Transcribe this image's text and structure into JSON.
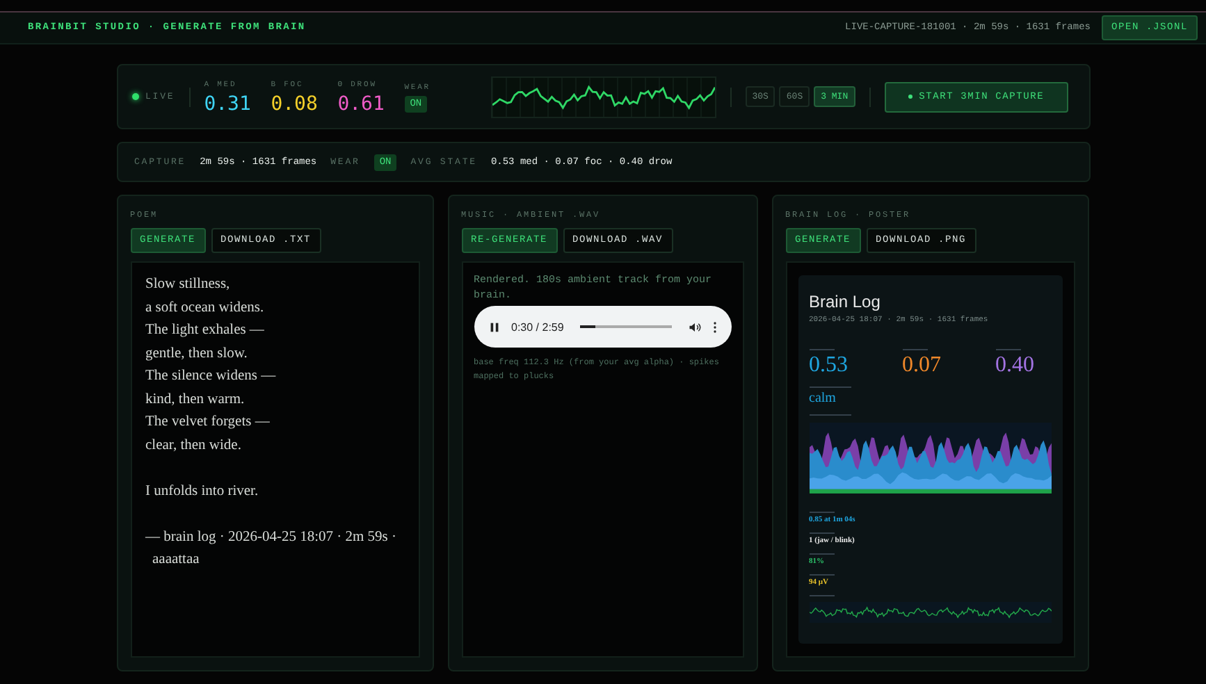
{
  "header": {
    "title": "BRAINBIT STUDIO · GENERATE FROM BRAIN",
    "session": "LIVE-CAPTURE-181001 · 2m 59s · 1631 frames",
    "action": "OPEN .JSONL"
  },
  "live": {
    "status": "LIVE",
    "on": true,
    "metrics": [
      {
        "label": "Α MED",
        "value": "0.31",
        "color": "#3fd4f4"
      },
      {
        "label": "Β FOC",
        "value": "0.08",
        "color": "#f4d02a"
      },
      {
        "label": "Θ DROW",
        "value": "0.61",
        "color": "#f05cc8"
      }
    ],
    "wear": {
      "label": "WEAR",
      "value": "ON",
      "on": true
    },
    "durations": [
      {
        "label": "30S",
        "selected": false
      },
      {
        "label": "60S",
        "selected": false
      },
      {
        "label": "3 MIN",
        "selected": true
      }
    ],
    "start": "START 3MIN CAPTURE"
  },
  "summary": {
    "capture_label": "CAPTURE",
    "capture": "2m 59s · 1631 frames",
    "wear_label": "WEAR",
    "wear": "ON",
    "wear_on": true,
    "avg_label": "AVG STATE",
    "avg": "0.53 med · 0.07 foc · 0.40 drow"
  },
  "panels": [
    {
      "kind": "poem",
      "title": "POEM",
      "buttons": [
        {
          "label": "GENERATE",
          "primary": true
        },
        {
          "label": "DOWNLOAD .TXT",
          "primary": false
        }
      ],
      "stanzas": [
        [
          "Slow stillness,",
          "a soft ocean widens.",
          "The light exhales —",
          "gentle, then slow.",
          "The silence widens —",
          "kind, then warm.",
          "The velvet forgets —",
          "clear, then wide."
        ],
        [
          "I unfolds into river."
        ],
        [
          "— brain log · 2026-04-25 18:07 · 2m 59s ·",
          "aaaattaa"
        ]
      ]
    },
    {
      "kind": "music",
      "title": "MUSIC · AMBIENT .WAV",
      "buttons": [
        {
          "label": "RE-GENERATE",
          "primary": true
        },
        {
          "label": "DOWNLOAD .WAV",
          "primary": false
        }
      ],
      "status": "Rendered. 180s ambient track from your brain.",
      "player": {
        "playing": true,
        "time": "0:30 / 2:59",
        "level": 0.17
      },
      "note": "base freq 112.3 Hz (from your avg alpha) · spikes mapped to plucks"
    },
    {
      "kind": "poster",
      "title": "BRAIN LOG · POSTER",
      "buttons": [
        {
          "label": "GENERATE",
          "primary": true
        },
        {
          "label": "DOWNLOAD .PNG",
          "primary": false
        }
      ],
      "poster": {
        "title": "Brain Log",
        "meta": "2026-04-25 18:07 · 2m 59s · 1631 frames",
        "scores": [
          {
            "value": "0.53",
            "color": "#1fa6e0"
          },
          {
            "value": "0.07",
            "color": "#f0882a"
          },
          {
            "value": "0.40",
            "color": "#a474e4"
          }
        ],
        "state": "calm",
        "stats": [
          {
            "value": "0.85 at 1m 04s",
            "color": "#1fa6e0"
          },
          {
            "value": "1 (jaw / blink)",
            "color": "#e8e8e8"
          },
          {
            "value": "81%",
            "color": "#2cc36a"
          },
          {
            "value": "94 µV",
            "color": "#e6c02a"
          }
        ]
      }
    }
  ]
}
